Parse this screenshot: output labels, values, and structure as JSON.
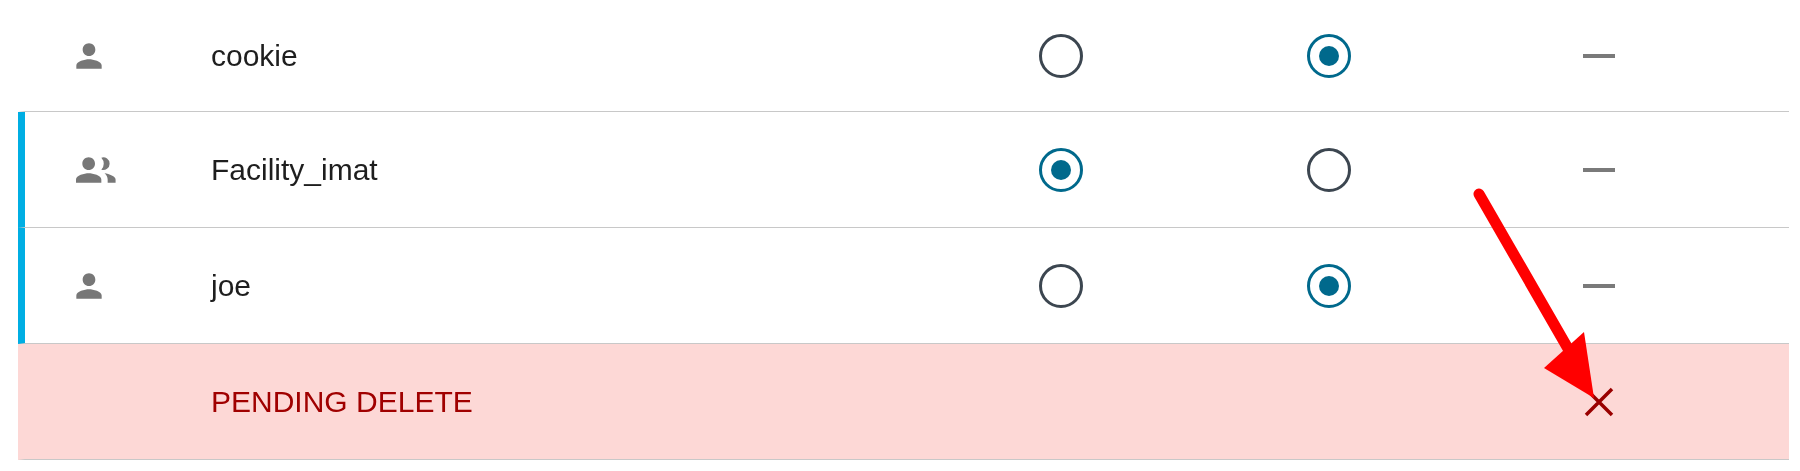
{
  "rows": [
    {
      "kind": "user",
      "name": "cookie",
      "highlighted": false,
      "choices": [
        {
          "selected": false
        },
        {
          "selected": true
        }
      ]
    },
    {
      "kind": "group",
      "name": "Facility_imat",
      "highlighted": true,
      "choices": [
        {
          "selected": true
        },
        {
          "selected": false
        }
      ]
    },
    {
      "kind": "user",
      "name": "joe",
      "highlighted": true,
      "choices": [
        {
          "selected": false
        },
        {
          "selected": true
        }
      ]
    },
    {
      "kind": "pending",
      "label": "PENDING DELETE"
    }
  ],
  "annotation": {
    "kind": "arrow"
  }
}
